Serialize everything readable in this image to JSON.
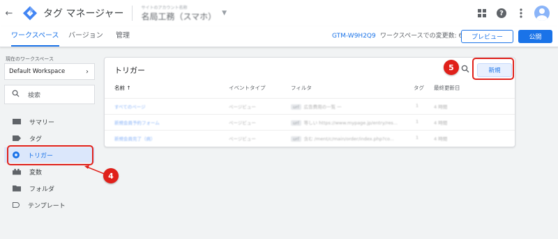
{
  "topbar": {
    "back_icon": "arrow-left-icon",
    "app_title": "タグ マネージャー",
    "account_line1": "サイトのアカウント名称",
    "account_line2": "名局工務（スマホ）",
    "apps_icon": "apps-grid-icon",
    "help_icon": "help-icon",
    "more_icon": "more-vert-icon",
    "avatar_icon": "avatar-icon"
  },
  "tabs": [
    {
      "label": "ワークスペース",
      "active": true
    },
    {
      "label": "バージョン",
      "active": false
    },
    {
      "label": "管理",
      "active": false
    }
  ],
  "header_right": {
    "container_id": "GTM-W9H2Q9",
    "changes_label": "ワークスペースでの変更数: 6",
    "preview_label": "プレビュー",
    "publish_label": "公開"
  },
  "sidebar": {
    "workspace_label": "現在のワークスペース",
    "workspace_name": "Default Workspace",
    "search_label": "検索",
    "items": [
      {
        "label": "サマリー",
        "icon": "summary-icon"
      },
      {
        "label": "タグ",
        "icon": "tag-icon"
      },
      {
        "label": "トリガー",
        "icon": "trigger-icon",
        "active": true
      },
      {
        "label": "変数",
        "icon": "variable-icon"
      },
      {
        "label": "フォルダ",
        "icon": "folder-icon"
      },
      {
        "label": "テンプレート",
        "icon": "template-icon"
      }
    ]
  },
  "main": {
    "title": "トリガー",
    "new_button": "新規",
    "columns": [
      "名前 ↑",
      "イベントタイプ",
      "フィルタ",
      "タグ",
      "最終更新日"
    ],
    "rows": [
      {
        "name": "すべてのページ",
        "event": "ページビュー",
        "filter_tag": "url",
        "filter": "広告費用の一覧 一",
        "tags": "1",
        "updated": "4 時間"
      },
      {
        "name": "新規会員予約フォーム",
        "event": "ページビュー",
        "filter_tag": "url",
        "filter": "等しい https://www.mypage.jp/entry/res...",
        "tags": "1",
        "updated": "4 時間"
      },
      {
        "name": "新規会員完了（病）",
        "event": "ページビュー",
        "filter_tag": "url",
        "filter": "含む /ment/c/main/order/index.php?co...",
        "tags": "1",
        "updated": "4 時間"
      }
    ]
  },
  "annotations": {
    "step4": "4",
    "step5": "5",
    "color": "#e0201a"
  }
}
